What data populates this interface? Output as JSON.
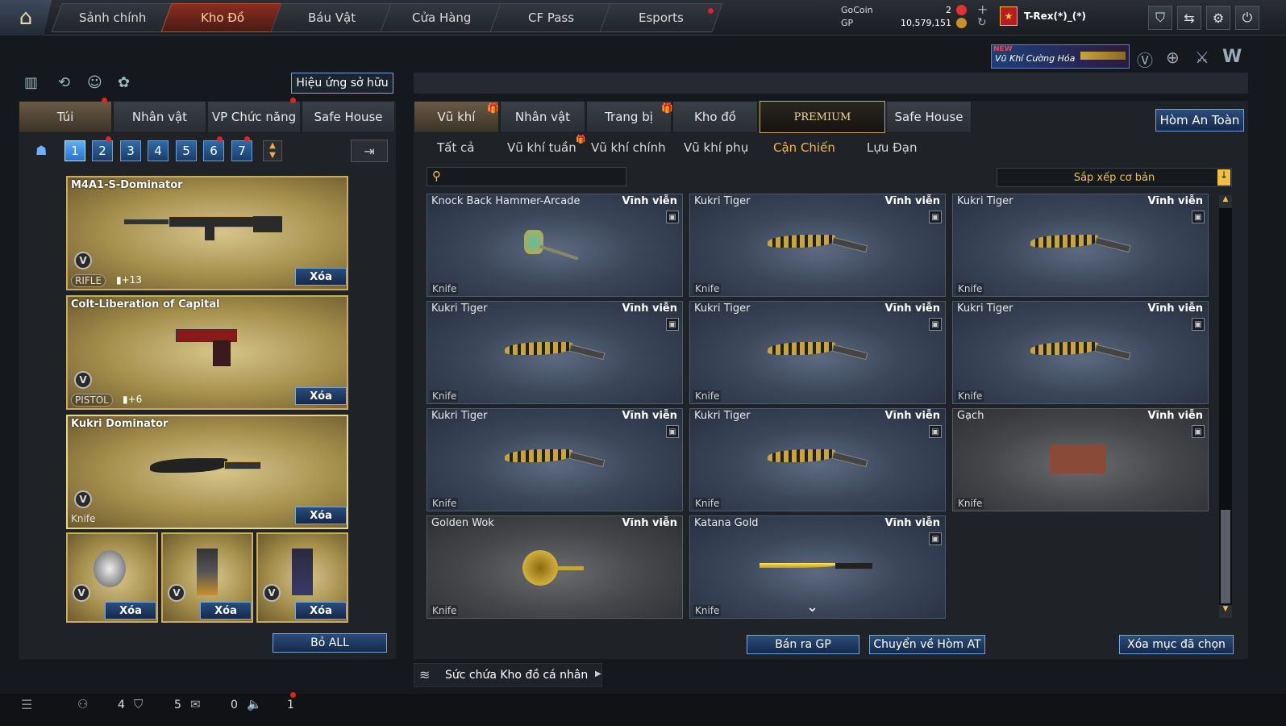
{
  "nav": {
    "tabs": [
      "Sảnh chính",
      "Kho Đồ",
      "Báu Vật",
      "Cửa Hàng",
      "CF Pass",
      "Esports"
    ]
  },
  "currency": {
    "gocoin_label": "GoCoin",
    "gocoin_value": "2",
    "gp_label": "GP",
    "gp_value": "10,579,151"
  },
  "user": {
    "name": "T-Rex(*)_(*)"
  },
  "banner": {
    "new": "NEW",
    "title": "Vũ Khí Cường Hóa"
  },
  "left": {
    "effects_button": "Hiệu ứng sở hữu",
    "tabs": [
      "Túi",
      "Nhân vật",
      "VP Chức năng",
      "Safe House"
    ],
    "bag_numbers": [
      "1",
      "2",
      "3",
      "4",
      "5",
      "6",
      "7"
    ],
    "slots": [
      {
        "name": "M4A1-S-Dominator",
        "type": "RIFLE",
        "ammo": "+13",
        "action": "Xóa"
      },
      {
        "name": "Colt-Liberation of Capital",
        "type": "PISTOL",
        "ammo": "+6",
        "action": "Xóa"
      },
      {
        "name": "Kukri Dominator",
        "type": "Knife",
        "action": "Xóa"
      }
    ],
    "grenades": [
      "Xóa",
      "Xóa",
      "Xóa"
    ],
    "remove_all": "Bỏ ALL"
  },
  "right": {
    "tabs": [
      "Vũ khí",
      "Nhân vật",
      "Trang bị",
      "Kho đồ",
      "PREMIUM",
      "Safe House"
    ],
    "safe_box_button": "Hòm An Toàn",
    "subtabs": [
      "Tất cả",
      "Vũ khí tuần",
      "Vũ khí chính",
      "Vũ khí phụ",
      "Cận Chiến",
      "Lựu Đạn"
    ],
    "sort": "Sắp xếp cơ bản",
    "items": [
      {
        "name": "Knock Back Hammer-Arcade",
        "duration": "Vĩnh viễn",
        "type": "Knife",
        "icon": "hammer"
      },
      {
        "name": "Kukri Tiger",
        "duration": "Vĩnh viễn",
        "type": "Knife",
        "icon": "kukri"
      },
      {
        "name": "Kukri Tiger",
        "duration": "Vĩnh viễn",
        "type": "Knife",
        "icon": "kukri"
      },
      {
        "name": "Kukri Tiger",
        "duration": "Vĩnh viễn",
        "type": "Knife",
        "icon": "kukri"
      },
      {
        "name": "Kukri Tiger",
        "duration": "Vĩnh viễn",
        "type": "Knife",
        "icon": "kukri"
      },
      {
        "name": "Kukri Tiger",
        "duration": "Vĩnh viễn",
        "type": "Knife",
        "icon": "kukri"
      },
      {
        "name": "Kukri Tiger",
        "duration": "Vĩnh viễn",
        "type": "Knife",
        "icon": "kukri"
      },
      {
        "name": "Kukri Tiger",
        "duration": "Vĩnh viễn",
        "type": "Knife",
        "icon": "kukri"
      },
      {
        "name": "Gạch",
        "duration": "Vĩnh viễn",
        "type": "Knife",
        "icon": "brick"
      },
      {
        "name": "Golden Wok",
        "duration": "Vĩnh viễn",
        "type": "Knife",
        "icon": "wok"
      },
      {
        "name": "Katana Gold",
        "duration": "Vĩnh viễn",
        "type": "Knife",
        "icon": "katana"
      }
    ],
    "sell_button": "Bán ra GP",
    "transfer_button": "Chuyển về Hòm AT",
    "delete_selected_button": "Xóa mục đã chọn",
    "capacity_label": "Sức chứa Kho đồ cá nhân"
  },
  "status": {
    "friends": "4",
    "clan": "5",
    "messages": "0",
    "sound": "1"
  }
}
